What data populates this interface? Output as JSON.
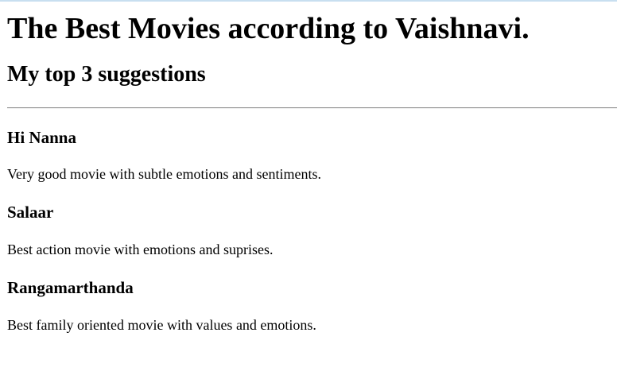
{
  "page": {
    "title": "The Best Movies according to Vaishnavi.",
    "subtitle": "My top 3 suggestions"
  },
  "movies": [
    {
      "name": "Hi Nanna",
      "description": "Very good movie with subtle emotions and sentiments."
    },
    {
      "name": "Salaar",
      "description": "Best action movie with emotions and suprises."
    },
    {
      "name": "Rangamarthanda",
      "description": "Best family oriented movie with values and emotions."
    }
  ],
  "colors": {
    "background": "#ffffff",
    "text": "#000000",
    "divider": "#9a9a9a",
    "top_edge": "#c8dff0"
  }
}
